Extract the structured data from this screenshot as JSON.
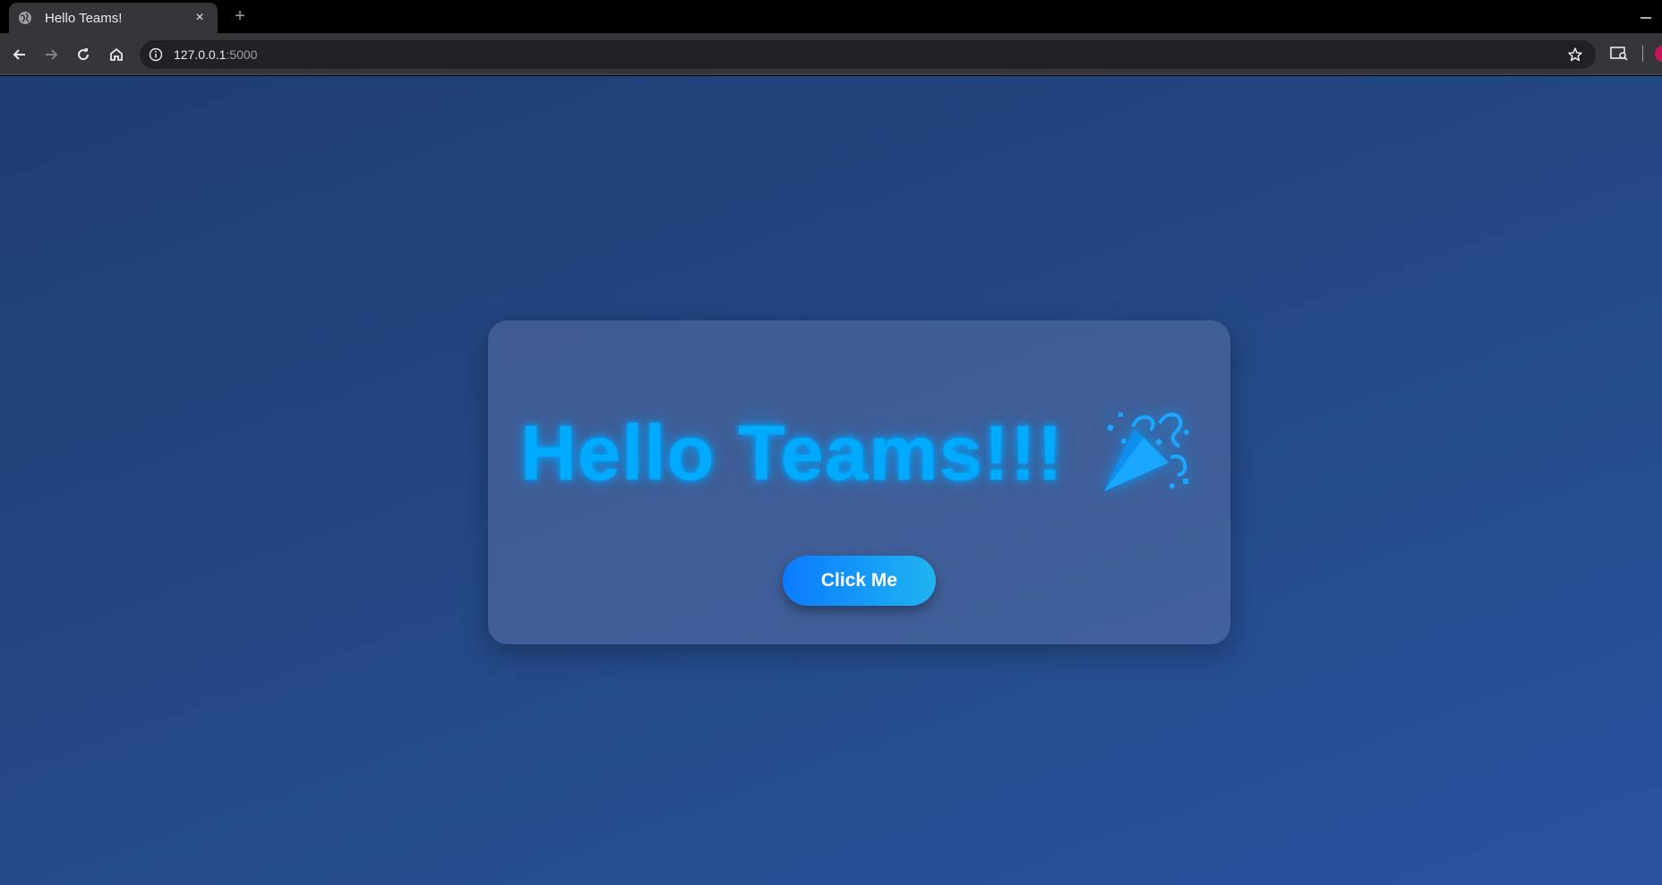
{
  "browser": {
    "tab": {
      "title": "Hello Teams!",
      "close": "×"
    },
    "new_tab": "+",
    "address": {
      "host": "127.0.0.1",
      "port": ":5000"
    }
  },
  "page": {
    "headline": "Hello Teams!!!",
    "headline_emoji": "party-popper-icon",
    "button_label": "Click Me",
    "colors": {
      "background_start": "#1f3d72",
      "background_end": "#2a52a0",
      "headline": "#00aaff",
      "button_start": "#0b7bff",
      "button_end": "#1fb4f0"
    }
  }
}
